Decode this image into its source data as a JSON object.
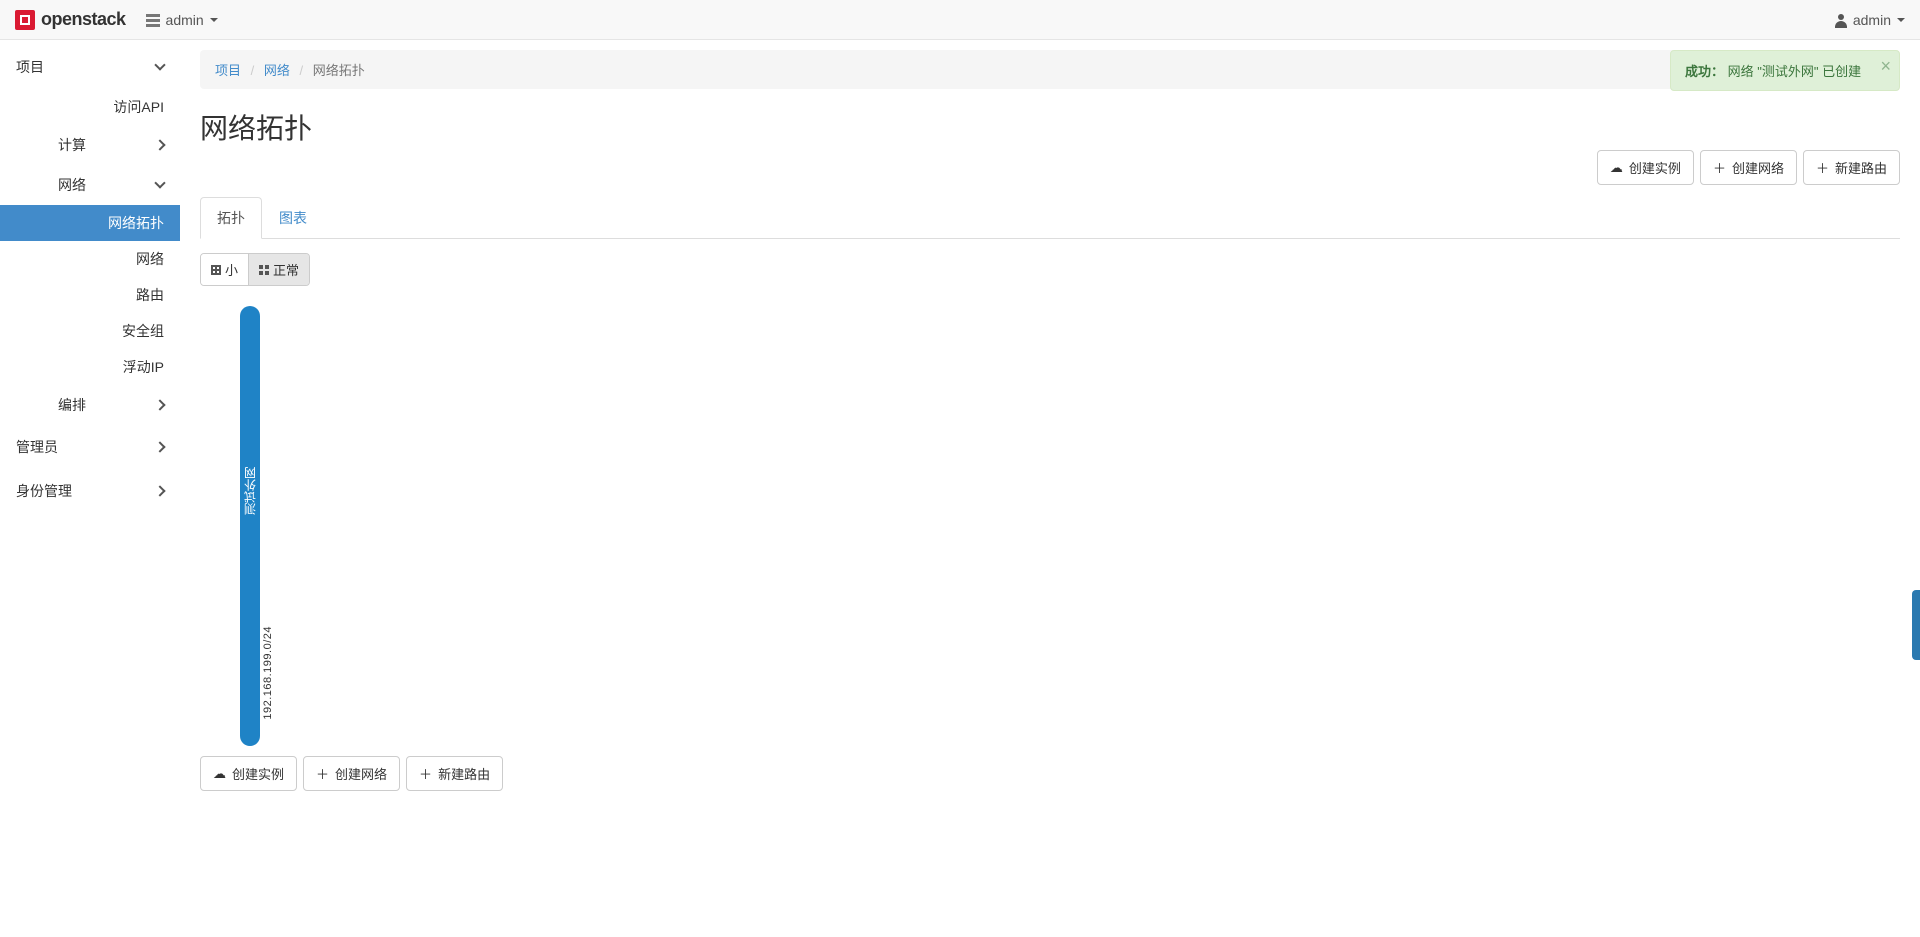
{
  "brand": {
    "name": "openstack"
  },
  "header": {
    "project_selector": "admin",
    "user_selector": "admin"
  },
  "sidebar": {
    "groups": {
      "project": {
        "label": "项目",
        "expanded": true
      },
      "admin_panel": {
        "label": "管理员",
        "expanded": false
      },
      "identity": {
        "label": "身份管理",
        "expanded": false
      }
    },
    "project_children": {
      "access_api": "访问API",
      "compute": {
        "label": "计算",
        "expanded": false
      },
      "network": {
        "label": "网络",
        "expanded": true
      },
      "orchestration": {
        "label": "编排",
        "expanded": false
      }
    },
    "network_children": {
      "topology": "网络拓扑",
      "networks": "网络",
      "routers": "路由",
      "security_groups": "安全组",
      "floating_ips": "浮动IP"
    }
  },
  "breadcrumb": {
    "item1": "项目",
    "item2": "网络",
    "item3": "网络拓扑"
  },
  "page": {
    "title": "网络拓扑"
  },
  "actions": {
    "launch_instance": "创建实例",
    "create_network": "创建网络",
    "create_router": "新建路由"
  },
  "tabs": {
    "topology": "拓扑",
    "graph": "图表"
  },
  "size_toggle": {
    "small": "小",
    "normal": "正常"
  },
  "topology": {
    "network_name": "测试外网",
    "cidr": "192.168.199.0/24"
  },
  "toast": {
    "prefix": "成功：",
    "message": "网络 \"测试外网\" 已创建"
  }
}
